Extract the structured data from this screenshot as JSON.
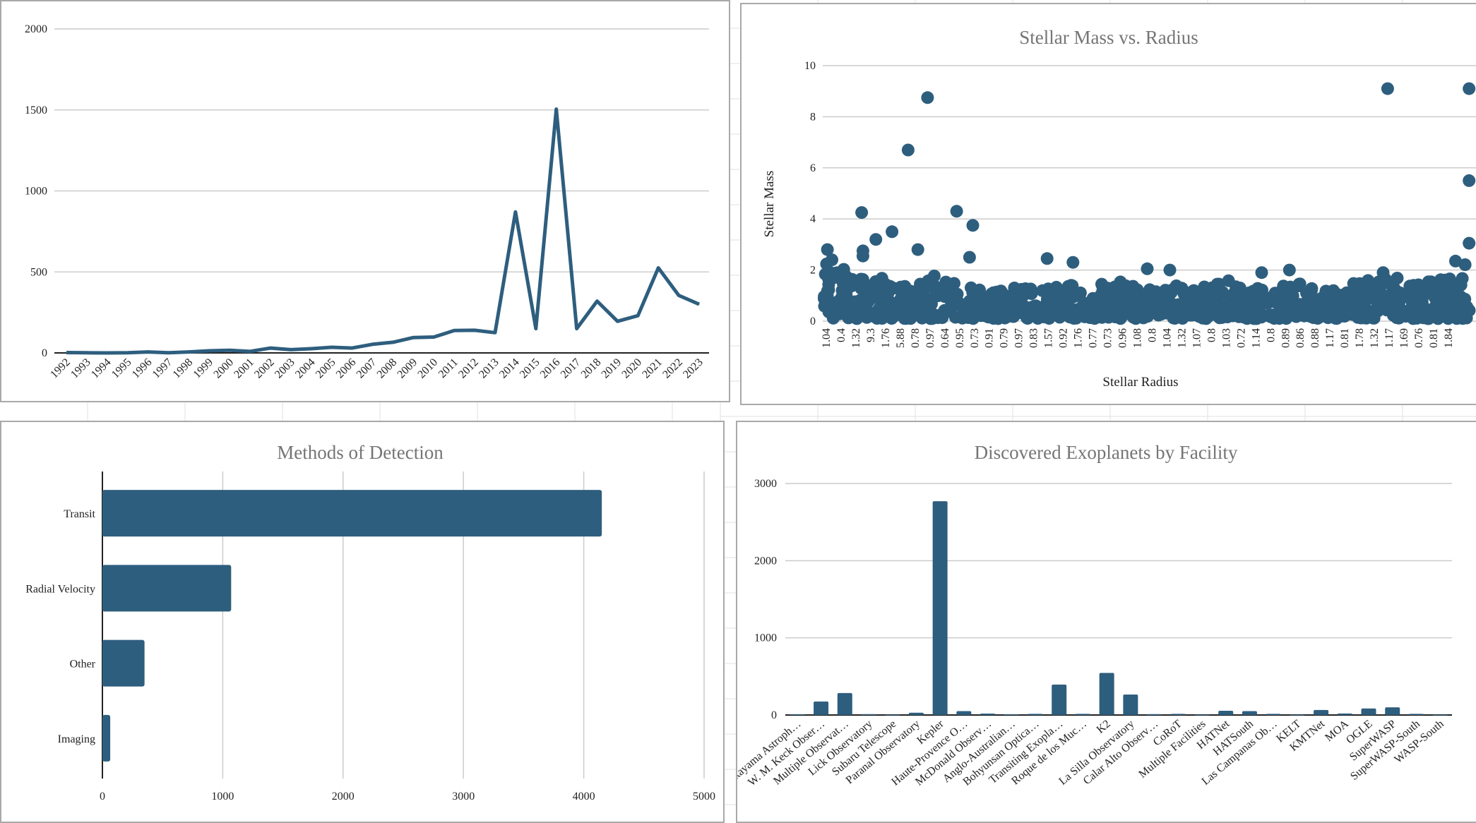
{
  "colors": {
    "series": "#2e5e7e",
    "grid": "#cccccc",
    "axis": "#222222",
    "title": "#757575"
  },
  "chart_data": [
    {
      "id": "discoveries",
      "type": "line",
      "title": "",
      "xlabel": "",
      "ylabel": "",
      "categories": [
        "1992",
        "1993",
        "1994",
        "1995",
        "1996",
        "1997",
        "1998",
        "1999",
        "2000",
        "2001",
        "2002",
        "2003",
        "2004",
        "2005",
        "2006",
        "2007",
        "2008",
        "2009",
        "2010",
        "2011",
        "2012",
        "2013",
        "2014",
        "2015",
        "2016",
        "2017",
        "2018",
        "2019",
        "2020",
        "2021",
        "2022",
        "2023"
      ],
      "values": [
        2,
        1,
        0,
        1,
        6,
        1,
        6,
        13,
        16,
        9,
        30,
        20,
        26,
        35,
        30,
        53,
        66,
        95,
        98,
        138,
        140,
        125,
        870,
        150,
        1505,
        150,
        320,
        195,
        230,
        525,
        355,
        300
      ],
      "yticks": [
        0,
        500,
        1000,
        1500,
        2000
      ],
      "ylim": [
        0,
        2000
      ],
      "grid": true
    },
    {
      "id": "mass_radius",
      "type": "scatter",
      "title": "Stellar Mass vs. Radius",
      "xlabel": "Stellar Radius",
      "ylabel": "Stellar Mass",
      "xcategories": [
        "1.04",
        "0.4",
        "1.32",
        "9.3",
        "1.76",
        "5.88",
        "0.78",
        "0.97",
        "0.64",
        "0.95",
        "0.73",
        "0.91",
        "0.79",
        "0.97",
        "0.83",
        "1.57",
        "0.92",
        "1.76",
        "0.77",
        "0.73",
        "0.96",
        "1.08",
        "0.8",
        "1.04",
        "1.32",
        "1.07",
        "0.8",
        "1.03",
        "0.72",
        "1.14",
        "0.8",
        "0.89",
        "0.86",
        "0.88",
        "1.17",
        "0.81",
        "1.78",
        "1.32",
        "1.17",
        "1.69",
        "0.76",
        "0.81",
        "1.84"
      ],
      "yticks": [
        0,
        2,
        4,
        6,
        8,
        10
      ],
      "ylim": [
        0,
        10
      ],
      "grid": true,
      "outliers": [
        {
          "x": 0.005,
          "y": 2.8
        },
        {
          "x": 0.01,
          "y": 1.9
        },
        {
          "x": 0.012,
          "y": 2.4
        },
        {
          "x": 0.058,
          "y": 4.25
        },
        {
          "x": 0.06,
          "y": 2.75
        },
        {
          "x": 0.06,
          "y": 2.55
        },
        {
          "x": 0.08,
          "y": 3.2
        },
        {
          "x": 0.105,
          "y": 3.5
        },
        {
          "x": 0.13,
          "y": 6.7
        },
        {
          "x": 0.145,
          "y": 2.8
        },
        {
          "x": 0.16,
          "y": 8.75
        },
        {
          "x": 0.205,
          "y": 4.3
        },
        {
          "x": 0.23,
          "y": 3.75
        },
        {
          "x": 0.225,
          "y": 2.5
        },
        {
          "x": 0.345,
          "y": 2.45
        },
        {
          "x": 0.385,
          "y": 2.3
        },
        {
          "x": 0.5,
          "y": 2.05
        },
        {
          "x": 0.535,
          "y": 2.0
        },
        {
          "x": 0.677,
          "y": 1.9
        },
        {
          "x": 0.72,
          "y": 2.0
        },
        {
          "x": 0.865,
          "y": 1.9
        },
        {
          "x": 0.872,
          "y": 9.1
        },
        {
          "x": 0.998,
          "y": 9.1
        },
        {
          "x": 0.998,
          "y": 5.5
        },
        {
          "x": 0.998,
          "y": 3.05
        }
      ],
      "band_max": [
        2.3,
        2.2,
        1.9,
        1.7,
        1.5,
        1.5,
        1.6,
        1.8,
        1.6,
        1.4,
        1.3,
        1.2,
        1.3,
        1.4,
        1.3,
        1.4,
        1.5,
        1.3,
        1.6,
        1.6,
        1.4,
        1.3,
        1.3,
        1.4,
        1.3,
        1.4,
        1.6,
        1.4,
        1.3,
        1.3,
        1.4,
        1.5,
        1.3,
        1.3,
        1.4,
        1.5,
        1.6,
        1.9,
        1.8,
        1.5,
        1.6,
        1.9,
        2.4
      ]
    },
    {
      "id": "methods",
      "type": "bar",
      "orientation": "horizontal",
      "title": "Methods of Detection",
      "xlabel": "",
      "ylabel": "",
      "categories": [
        "Transit",
        "Radial Velocity",
        "Other",
        "Imaging"
      ],
      "values": [
        4150,
        1070,
        350,
        65
      ],
      "xticks": [
        0,
        1000,
        2000,
        3000,
        4000,
        5000
      ],
      "xlim": [
        0,
        5000
      ],
      "grid": true
    },
    {
      "id": "facilities",
      "type": "bar",
      "title": "Discovered Exoplanets by Facility",
      "xlabel": "",
      "ylabel": "",
      "categories": [
        "Okayama Astroph…",
        "W. M. Keck Obser…",
        "Multiple Observat…",
        "Lick Observatory",
        "Subaru Telescope",
        "Paranal Observatory",
        "Kepler",
        "Haute-Provence O…",
        "McDonald Observ…",
        "Anglo-Australian…",
        "Bohyunsan Optica…",
        "Transiting Exopla…",
        "Roque de los Muc…",
        "K2",
        "La Silla Observatory",
        "Calar Alto Observ…",
        "CoRoT",
        "Multiple Facilities",
        "HATNet",
        "HATSouth",
        "Las Campanas Ob…",
        "KELT",
        "KMTNet",
        "MOA",
        "OGLE",
        "SuperWASP",
        "SuperWASP-South",
        "WASP-South"
      ],
      "values": [
        10,
        175,
        285,
        12,
        4,
        30,
        2770,
        50,
        18,
        10,
        15,
        395,
        15,
        545,
        265,
        12,
        15,
        4,
        55,
        50,
        15,
        4,
        65,
        20,
        85,
        100,
        15,
        4
      ],
      "yticks": [
        0,
        1000,
        2000,
        3000
      ],
      "ylim": [
        0,
        3000
      ],
      "grid": true
    }
  ]
}
